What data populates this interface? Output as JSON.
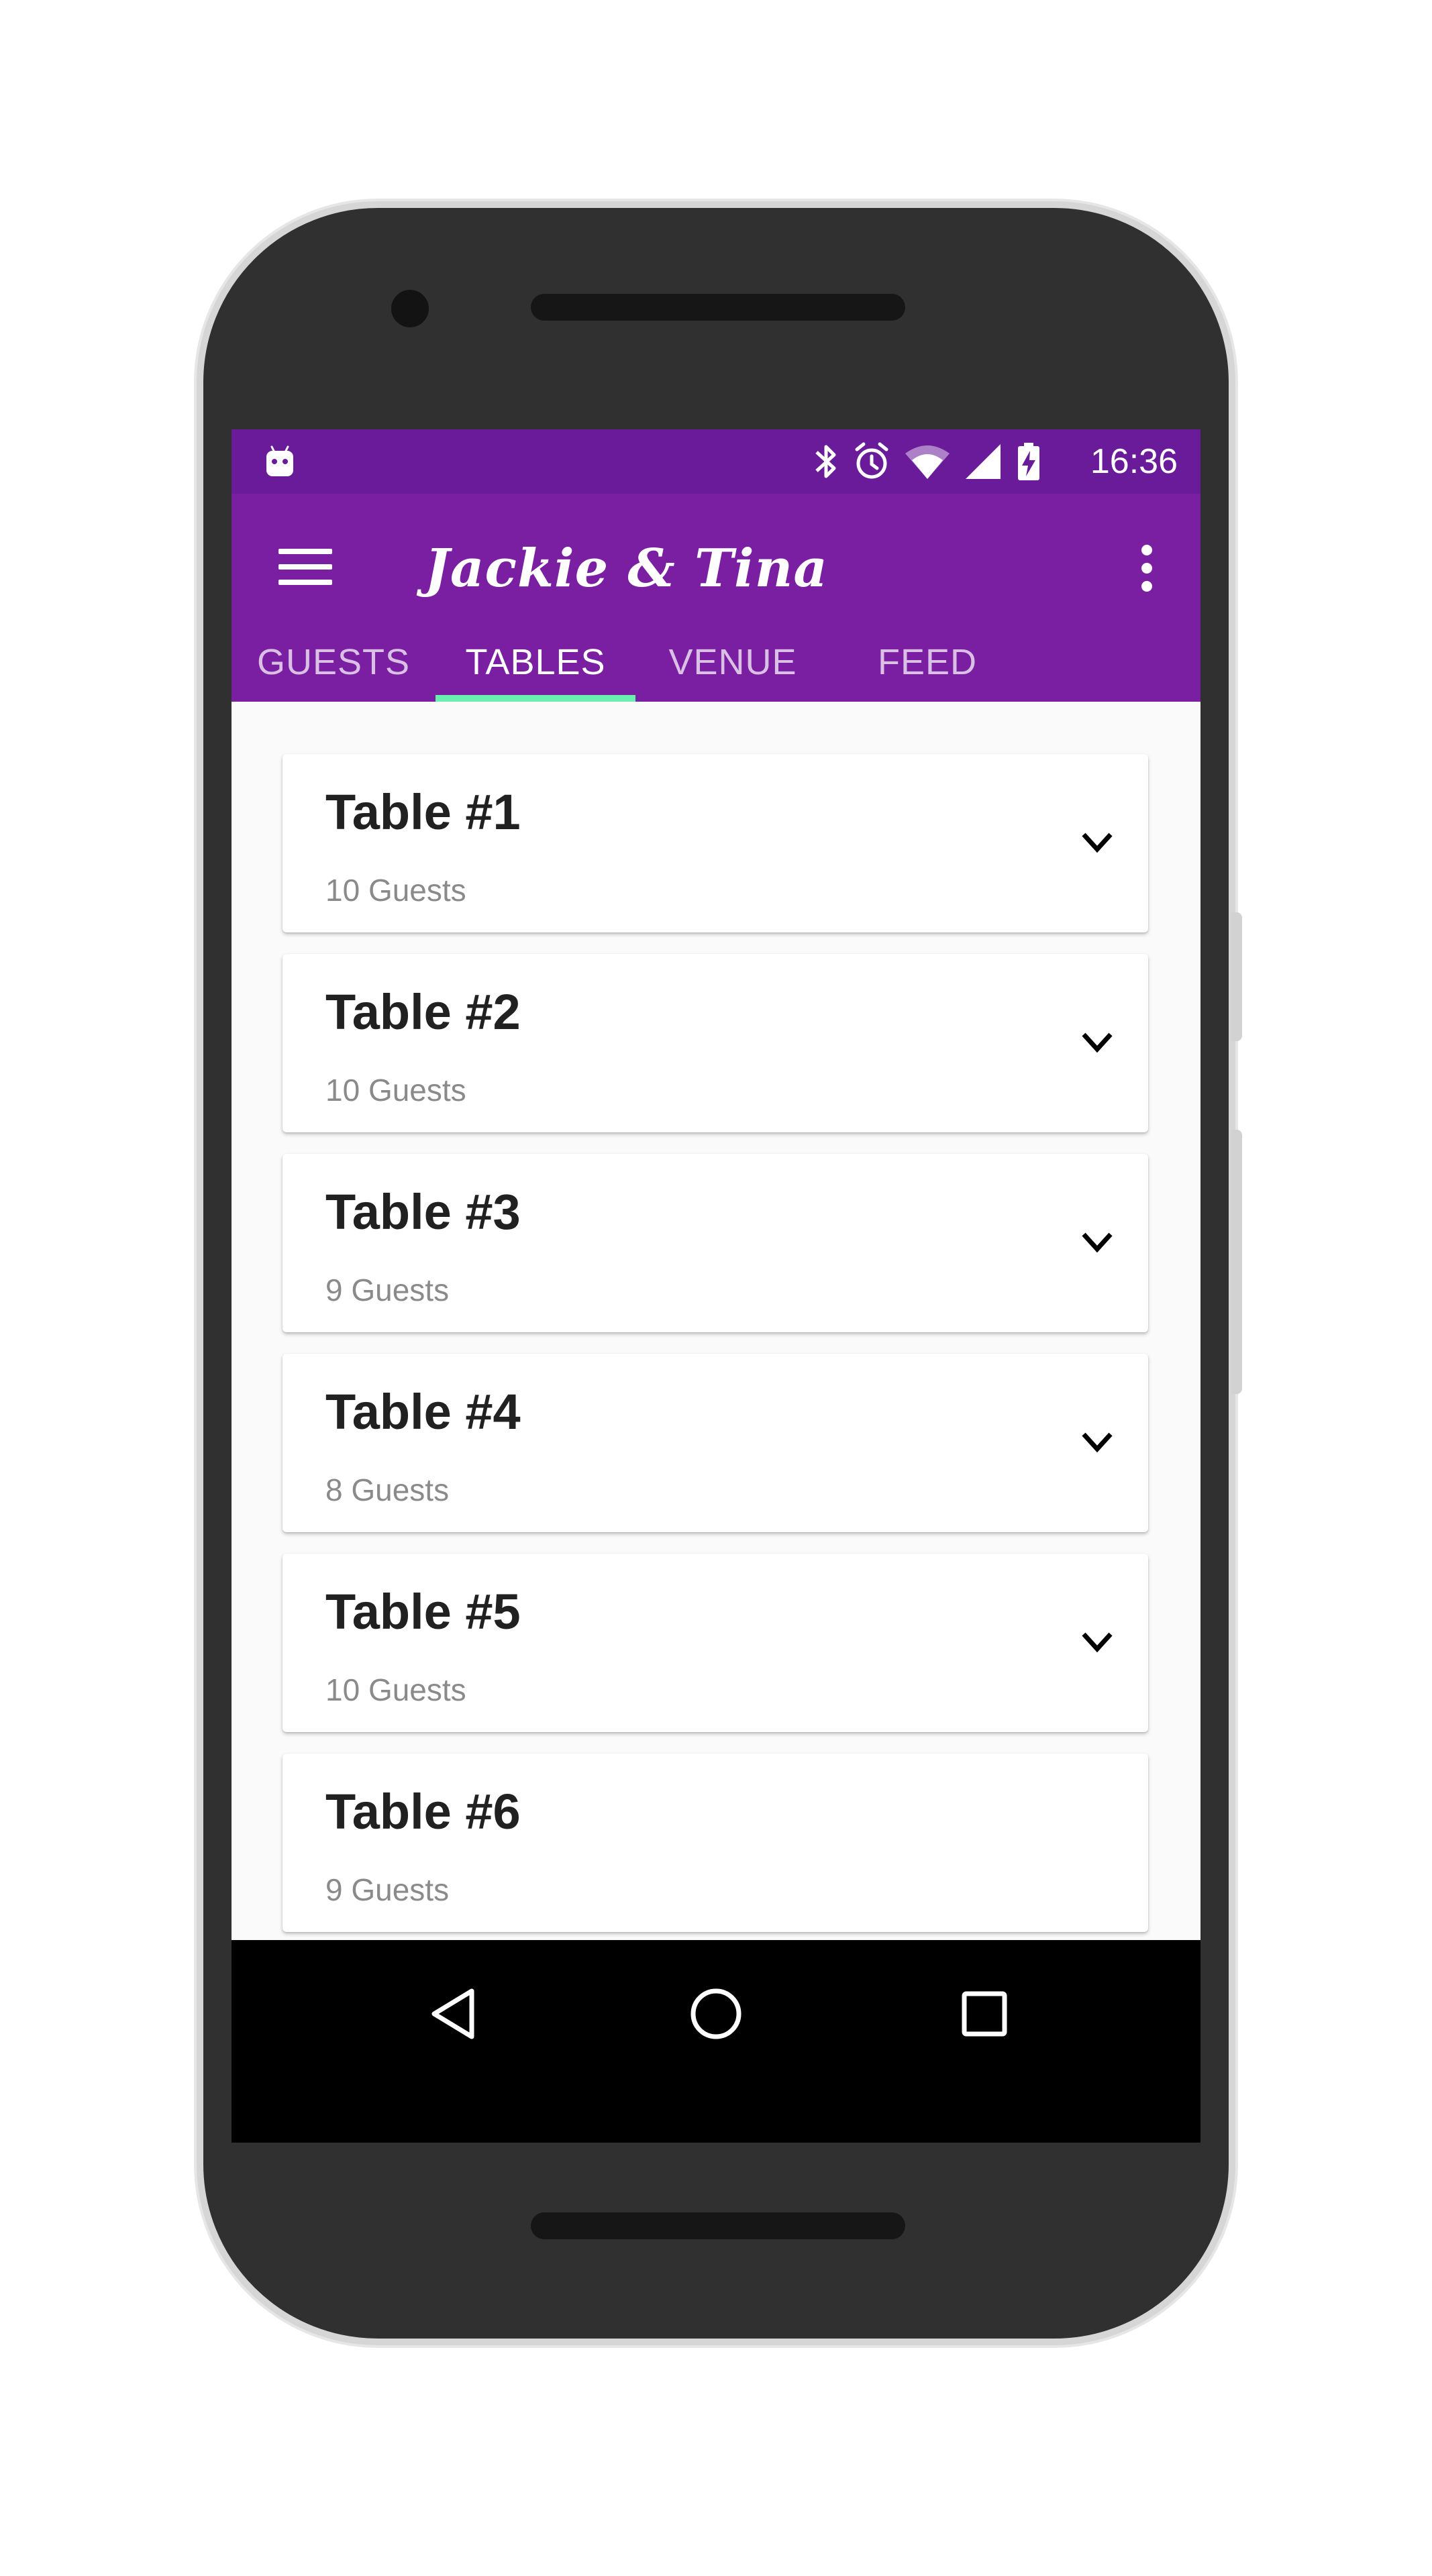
{
  "status_bar": {
    "time": "16:36",
    "icons": [
      "android-notification-icon",
      "bluetooth-icon",
      "alarm-icon",
      "wifi-icon",
      "signal-icon",
      "battery-charging-icon"
    ]
  },
  "app_bar": {
    "title": "Jackie & Tina",
    "menu_icon": "menu-icon",
    "overflow_icon": "more-vert-icon"
  },
  "tabs": [
    {
      "label": "GUESTS",
      "active": false
    },
    {
      "label": "TABLES",
      "active": true
    },
    {
      "label": "VENUE",
      "active": false
    },
    {
      "label": "FEED",
      "active": false
    }
  ],
  "tables": [
    {
      "name": "Table #1",
      "guests": "10 Guests"
    },
    {
      "name": "Table #2",
      "guests": "10 Guests"
    },
    {
      "name": "Table #3",
      "guests": "9 Guests"
    },
    {
      "name": "Table #4",
      "guests": "8 Guests"
    },
    {
      "name": "Table #5",
      "guests": "10 Guests"
    },
    {
      "name": "Table #6",
      "guests": "9 Guests"
    }
  ],
  "fab": {
    "icon": "add-group-icon"
  },
  "colors": {
    "status_bar": "#6a1b9a",
    "app_bar": "#7b1fa2",
    "accent": "#69f0ae",
    "background": "#fafafa"
  },
  "nav_bar": {
    "buttons": [
      "back-icon",
      "home-icon",
      "recents-icon"
    ]
  }
}
